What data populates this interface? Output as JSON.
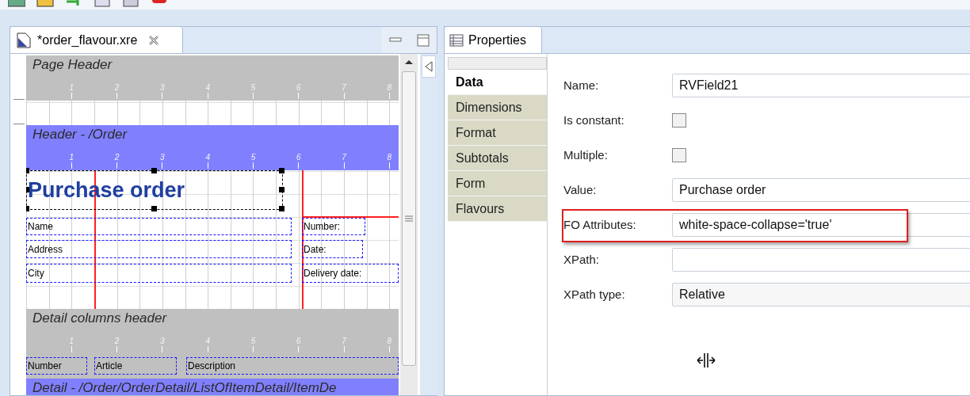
{
  "editor": {
    "tab": {
      "title": "*order_flavour.xre",
      "selected": true
    },
    "bands": [
      {
        "title": "Page Header",
        "color": "#c0c0c0",
        "body_shaded": false,
        "ruler": [
          "1",
          "2",
          "3",
          "4",
          "5",
          "6",
          "7",
          "8"
        ]
      },
      {
        "title": "Header - /Order",
        "color": "#8080ff",
        "body_shaded": false,
        "ruler": [
          "1",
          "2",
          "3",
          "4",
          "5",
          "6",
          "7",
          "8"
        ],
        "fields": [
          {
            "text": "Purchase order",
            "kind": "title",
            "selected": true
          },
          {
            "text": "Name",
            "kind": "label",
            "selected": false
          },
          {
            "text": "Address",
            "kind": "label",
            "selected": false
          },
          {
            "text": "City",
            "kind": "label",
            "selected": false
          },
          {
            "text": "Number:",
            "kind": "label",
            "selected": false
          },
          {
            "text": "Date:",
            "kind": "label",
            "selected": false
          },
          {
            "text": "Delivery date:",
            "kind": "label",
            "selected": false
          }
        ]
      },
      {
        "title": "Detail columns header",
        "color": "#c0c0c0",
        "body_shaded": true,
        "ruler": [
          "1",
          "2",
          "3",
          "4",
          "5",
          "6",
          "7",
          "8"
        ],
        "fields": [
          {
            "text": "Number",
            "kind": "label",
            "selected": false
          },
          {
            "text": "Article",
            "kind": "label",
            "selected": false
          },
          {
            "text": "Description",
            "kind": "label",
            "selected": false
          }
        ]
      },
      {
        "title": "Detail - /Order/OrderDetail/ListOfItemDetail/ItemDe",
        "color": "#8080ff"
      }
    ]
  },
  "properties": {
    "tab": {
      "title": "Properties",
      "selected": true
    },
    "sections": [
      {
        "label": "Data",
        "selected": true
      },
      {
        "label": "Dimensions",
        "selected": false
      },
      {
        "label": "Format",
        "selected": false
      },
      {
        "label": "Subtotals",
        "selected": false
      },
      {
        "label": "Form",
        "selected": false
      },
      {
        "label": "Flavours",
        "selected": false
      }
    ],
    "rows": [
      {
        "label": "Name:",
        "kind": "text",
        "value": "RVField21",
        "highlighted": false
      },
      {
        "label": "Is constant:",
        "kind": "checkbox",
        "checked": false,
        "highlighted": false
      },
      {
        "label": "Multiple:",
        "kind": "checkbox",
        "checked": false,
        "highlighted": false
      },
      {
        "label": "Value:",
        "kind": "text",
        "value": "Purchase order",
        "highlighted": false
      },
      {
        "label": "FO Attributes:",
        "kind": "text",
        "value": "white-space-collapse='true'",
        "highlighted": true
      },
      {
        "label": "XPath:",
        "kind": "text",
        "highlighted": false
      },
      {
        "label": "XPath type:",
        "kind": "select",
        "value": "Relative",
        "highlighted": false
      }
    ]
  }
}
